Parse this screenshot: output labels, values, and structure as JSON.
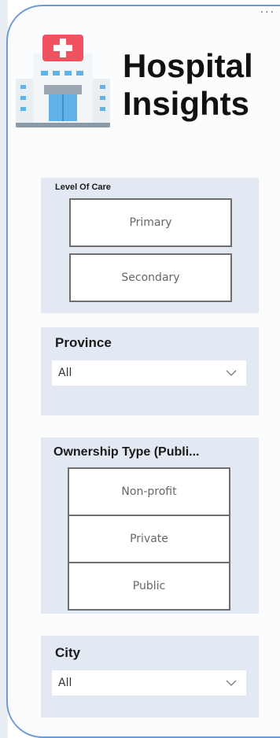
{
  "header": {
    "more_label": "···",
    "title_line1": "Hospital",
    "title_line2": "Insights"
  },
  "level_of_care": {
    "label": "Level Of Care",
    "options": [
      "Primary",
      "Secondary"
    ]
  },
  "province": {
    "label": "Province",
    "value": "All"
  },
  "ownership": {
    "label": "Ownership Type (Publi...",
    "options": [
      "Non-profit",
      "Private",
      "Public"
    ]
  },
  "city": {
    "label": "City",
    "value": "All"
  },
  "colors": {
    "accent_border": "#6f9bd4",
    "card_background": "#e3e9f2",
    "logo_red": "#f0525f",
    "logo_blue": "#5fb3e6"
  },
  "icons": {
    "logo": "hospital-building-icon",
    "dropdown": "chevron-down-icon",
    "menu": "more-options-icon"
  }
}
